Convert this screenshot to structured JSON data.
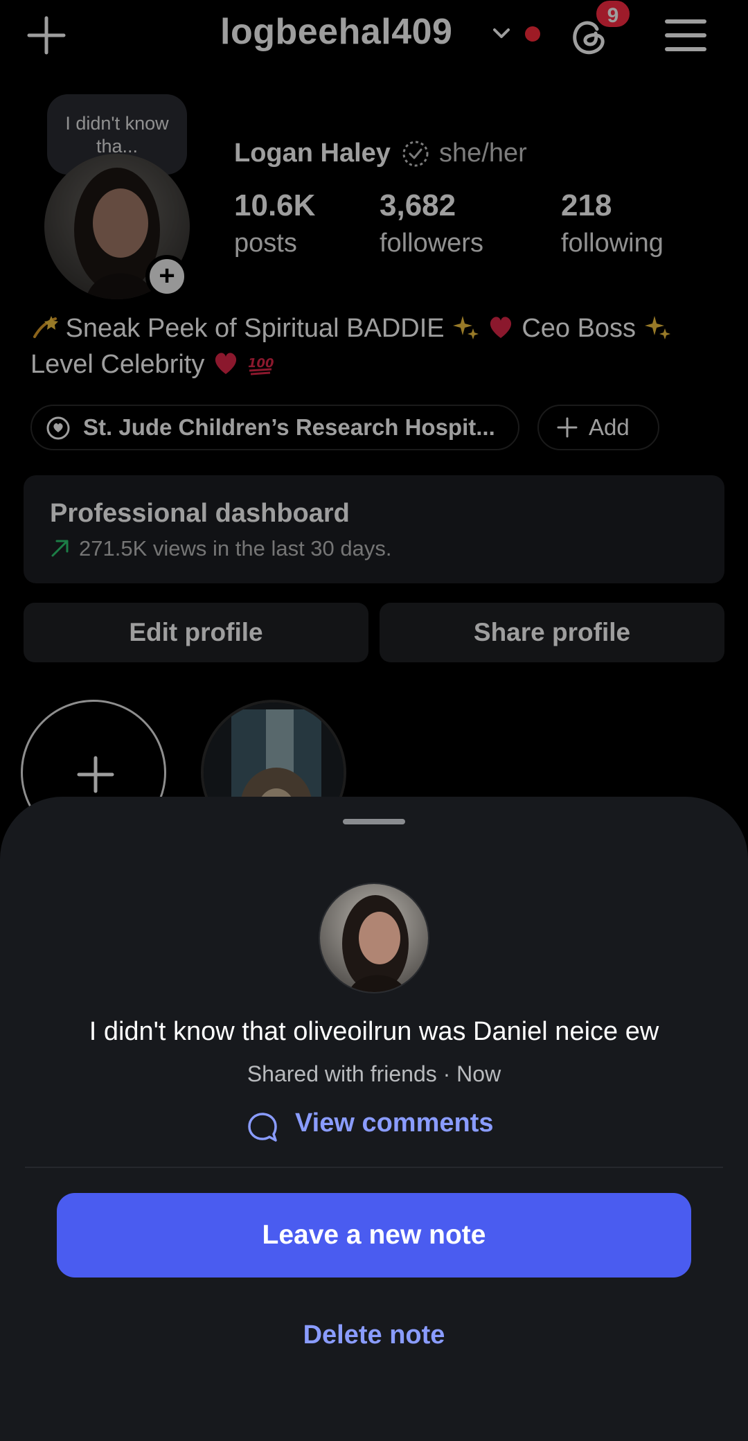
{
  "topbar": {
    "username": "logbeehal409",
    "notification_count": "9"
  },
  "profile": {
    "note_preview": "I didn't know tha...",
    "display_name": "Logan Haley",
    "pronouns": "she/her",
    "stats": [
      {
        "value": "10.6K",
        "label": "posts"
      },
      {
        "value": "3,682",
        "label": "followers"
      },
      {
        "value": "218",
        "label": "following"
      }
    ],
    "bio_line1": "Sneak Peek of Spiritual BADDIE",
    "bio_line1b": "Ceo Boss",
    "bio_line2": "Level Celebrity",
    "cause_label": "St. Jude Children’s Research Hospit...",
    "add_label": "Add",
    "dashboard_title": "Professional dashboard",
    "dashboard_sub": "271.5K views in the last 30 days.",
    "edit_profile": "Edit profile",
    "share_profile": "Share profile"
  },
  "sheet": {
    "note_text": "I didn't know that oliveoilrun was Daniel neice ew",
    "note_meta": "Shared with friends · Now",
    "view_comments": "View comments",
    "leave_note": "Leave a new note",
    "delete_note": "Delete note"
  },
  "colors": {
    "accent": "#4a5cf0",
    "link": "#8a9cff",
    "sheet_bg": "#17191d",
    "badge": "#ff2d45"
  }
}
